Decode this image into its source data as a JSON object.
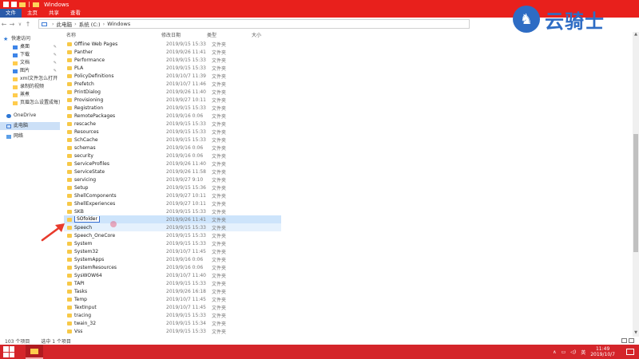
{
  "window": {
    "title": "Windows"
  },
  "ribbon": {
    "tabs": [
      "文件",
      "主页",
      "共享",
      "查看"
    ],
    "active_tab": "文件"
  },
  "address": {
    "segments": [
      "此电脑",
      "系统 (C:)",
      "Windows"
    ]
  },
  "logo": {
    "text": "云骑士"
  },
  "nav": {
    "quick_access": "快速访问",
    "items": [
      {
        "label": "桌面",
        "icon": "desktop-icon",
        "pinned": true
      },
      {
        "label": "下载",
        "icon": "download-icon",
        "pinned": true
      },
      {
        "label": "文档",
        "icon": "documents-icon",
        "pinned": true
      },
      {
        "label": "图片",
        "icon": "pictures-icon",
        "pinned": true
      },
      {
        "label": "xml文件怎么打开",
        "icon": "folder-icon",
        "pinned": false
      },
      {
        "label": "录制的视频",
        "icon": "folder-icon",
        "pinned": false
      },
      {
        "label": "蒸煮",
        "icon": "folder-icon",
        "pinned": false
      },
      {
        "label": "页眉怎么设置成每页",
        "icon": "folder-icon",
        "pinned": false
      }
    ],
    "onedrive": "OneDrive",
    "this_pc": "此电脑",
    "network": "网络"
  },
  "columns": {
    "name": "名称",
    "date": "修改日期",
    "type": "类型",
    "size": "大小"
  },
  "files": [
    {
      "name": "Offline Web Pages",
      "date": "2019/9/15 15:33",
      "type": "文件夹"
    },
    {
      "name": "Panther",
      "date": "2019/9/26 11:41",
      "type": "文件夹"
    },
    {
      "name": "Performance",
      "date": "2019/9/15 15:33",
      "type": "文件夹"
    },
    {
      "name": "PLA",
      "date": "2019/9/15 15:33",
      "type": "文件夹"
    },
    {
      "name": "PolicyDefinitions",
      "date": "2019/10/7 11:39",
      "type": "文件夹"
    },
    {
      "name": "Prefetch",
      "date": "2019/10/7 11:46",
      "type": "文件夹"
    },
    {
      "name": "PrintDialog",
      "date": "2019/9/26 11:40",
      "type": "文件夹"
    },
    {
      "name": "Provisioning",
      "date": "2019/9/27 10:11",
      "type": "文件夹"
    },
    {
      "name": "Registration",
      "date": "2019/9/15 15:33",
      "type": "文件夹"
    },
    {
      "name": "RemotePackages",
      "date": "2019/9/16 0:06",
      "type": "文件夹"
    },
    {
      "name": "rescache",
      "date": "2019/9/15 15:33",
      "type": "文件夹"
    },
    {
      "name": "Resources",
      "date": "2019/9/15 15:33",
      "type": "文件夹"
    },
    {
      "name": "SchCache",
      "date": "2019/9/15 15:33",
      "type": "文件夹"
    },
    {
      "name": "schemas",
      "date": "2019/9/16 0:06",
      "type": "文件夹"
    },
    {
      "name": "security",
      "date": "2019/9/16 0:06",
      "type": "文件夹"
    },
    {
      "name": "ServiceProfiles",
      "date": "2019/9/26 11:40",
      "type": "文件夹"
    },
    {
      "name": "ServiceState",
      "date": "2019/9/26 11:58",
      "type": "文件夹"
    },
    {
      "name": "servicing",
      "date": "2019/9/27 9:10",
      "type": "文件夹"
    },
    {
      "name": "Setup",
      "date": "2019/9/15 15:36",
      "type": "文件夹"
    },
    {
      "name": "ShellComponents",
      "date": "2019/9/27 10:11",
      "type": "文件夹"
    },
    {
      "name": "ShellExperiences",
      "date": "2019/9/27 10:11",
      "type": "文件夹"
    },
    {
      "name": "SKB",
      "date": "2019/9/15 15:33",
      "type": "文件夹"
    },
    {
      "name": "SOfolder",
      "date": "2019/9/26 11:41",
      "type": "文件夹",
      "state": "renaming"
    },
    {
      "name": "Speech",
      "date": "2019/9/15 15:33",
      "type": "文件夹",
      "state": "hover"
    },
    {
      "name": "Speech_OneCore",
      "date": "2019/9/15 15:33",
      "type": "文件夹"
    },
    {
      "name": "System",
      "date": "2019/9/15 15:33",
      "type": "文件夹"
    },
    {
      "name": "System32",
      "date": "2019/10/7 11:45",
      "type": "文件夹"
    },
    {
      "name": "SystemApps",
      "date": "2019/9/16 0:06",
      "type": "文件夹"
    },
    {
      "name": "SystemResources",
      "date": "2019/9/16 0:06",
      "type": "文件夹"
    },
    {
      "name": "SysWOW64",
      "date": "2019/10/7 11:40",
      "type": "文件夹"
    },
    {
      "name": "TAPI",
      "date": "2019/9/15 15:33",
      "type": "文件夹"
    },
    {
      "name": "Tasks",
      "date": "2019/9/26 16:18",
      "type": "文件夹"
    },
    {
      "name": "Temp",
      "date": "2019/10/7 11:45",
      "type": "文件夹"
    },
    {
      "name": "TextInput",
      "date": "2019/10/7 11:45",
      "type": "文件夹"
    },
    {
      "name": "tracing",
      "date": "2019/9/15 15:33",
      "type": "文件夹"
    },
    {
      "name": "twain_32",
      "date": "2019/9/15 15:34",
      "type": "文件夹"
    },
    {
      "name": "Vss",
      "date": "2019/9/15 15:33",
      "type": "文件夹"
    }
  ],
  "status": {
    "count": "103 个项目",
    "selected": "选中 1 个项目"
  },
  "taskbar": {
    "ime": "英",
    "time": "11:49",
    "date": "2019/10/7"
  },
  "colors": {
    "accent": "#e8201c",
    "taskbar": "#d4252a",
    "selection": "#cde4fb",
    "annotation_arrow": "#e83a2c"
  }
}
